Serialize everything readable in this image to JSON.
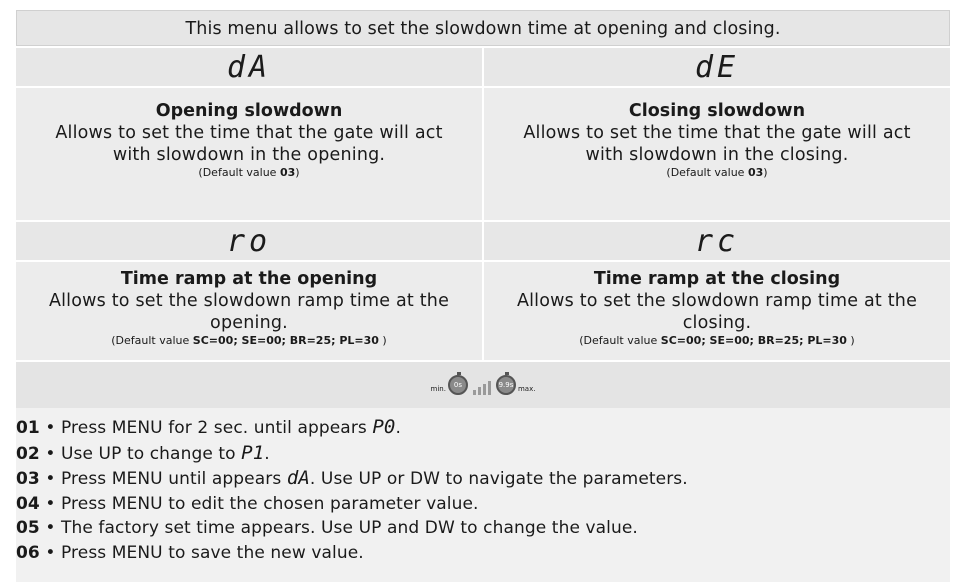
{
  "header": {
    "text": "This menu allows to set the slowdown time at opening and closing."
  },
  "parameters": [
    {
      "code_on": "dA",
      "code_off": "",
      "title": "Opening slowdown",
      "description_1": "Allows to set the time that the gate will act",
      "description_2": "with slowdown in the opening.",
      "default_prefix": "(Default value ",
      "default_value": "03",
      "default_suffix": ")"
    },
    {
      "code_on": "dE",
      "code_off": "",
      "title": "Closing slowdown",
      "description_1": "Allows to set the time that the gate will act",
      "description_2": "with slowdown in the closing.",
      "default_prefix": "(Default value ",
      "default_value": "03",
      "default_suffix": ")"
    },
    {
      "code_on": "ro",
      "code_off": "",
      "title": "Time ramp at the opening",
      "description_1": "Allows to set the slowdown ramp time at the",
      "description_2": "opening.",
      "default_prefix": "(Default value ",
      "default_value": "SC=00; SE=00; BR=25; PL=30",
      "default_suffix": " )"
    },
    {
      "code_on": "rc",
      "code_off": "",
      "title": "Time ramp at the closing",
      "description_1": "Allows to set the slowdown ramp time at the",
      "description_2": "closing.",
      "default_prefix": "(Default value ",
      "default_value": "SC=00; SE=00; BR=25; PL=30",
      "default_suffix": " )"
    }
  ],
  "ramp": {
    "min_label": "min.",
    "min_value": "0s",
    "max_value": "9.9s",
    "max_label": "max."
  },
  "steps": [
    {
      "num": "01",
      "text_a": " • Press MENU for 2 sec. until appears ",
      "code": "P0",
      "text_b": "."
    },
    {
      "num": "02",
      "text_a": " • Use UP to change to ",
      "code": "P1",
      "text_b": "."
    },
    {
      "num": "03",
      "text_a": " • Press MENU until appears ",
      "code": "dA",
      "text_b": ". Use UP or DW to navigate the parameters."
    },
    {
      "num": "04",
      "text_a": " • Press MENU to edit the chosen parameter value.",
      "code": "",
      "text_b": ""
    },
    {
      "num": "05",
      "text_a": " • The factory set time appears. Use UP and DW to change the value.",
      "code": "",
      "text_b": ""
    },
    {
      "num": "06",
      "text_a": " • Press MENU to save the new value.",
      "code": "",
      "text_b": ""
    }
  ]
}
